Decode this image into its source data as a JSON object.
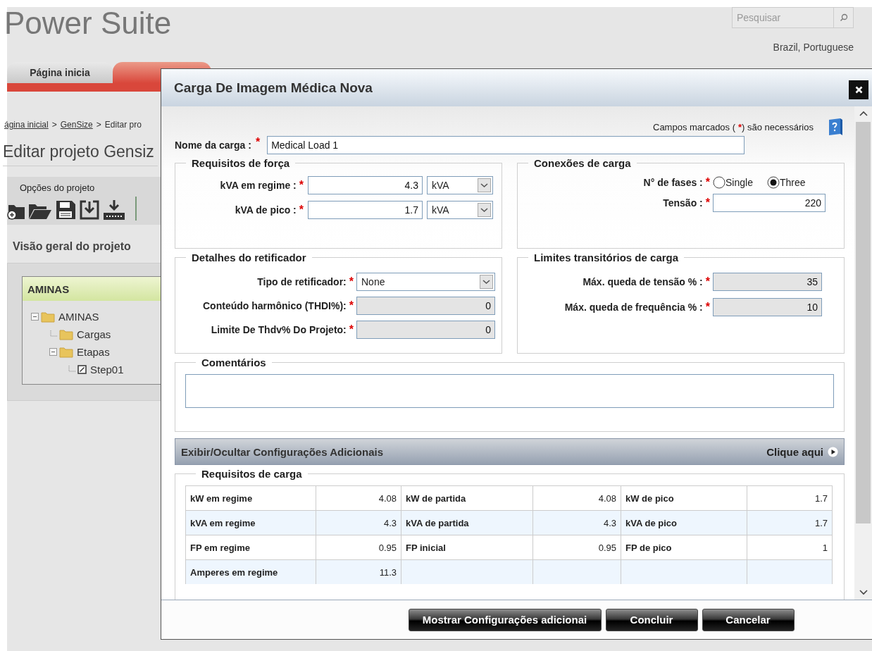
{
  "header": {
    "logo": "Power Suite",
    "search": {
      "placeholder": "Pesquisar"
    },
    "locale": "Brazil, Portuguese"
  },
  "nav_tabs": [
    {
      "label": "Página inicia",
      "selected": false
    }
  ],
  "breadcrumb": {
    "items": [
      "ágina inicial",
      "GenSize",
      "Editar pro"
    ],
    "separator": ">"
  },
  "page_title": "Editar projeto Gensiz",
  "project_options": {
    "title": "Opções do projeto"
  },
  "overview": {
    "title": "Visão geral do projeto",
    "project": "AMINAS",
    "tree": [
      {
        "label": "AMINAS",
        "kind": "folder",
        "expanded": true,
        "children": [
          {
            "label": "Cargas",
            "kind": "folder"
          },
          {
            "label": "Etapas",
            "kind": "folder",
            "expanded": true,
            "children": [
              {
                "label": "Step01",
                "kind": "step"
              }
            ]
          }
        ]
      }
    ]
  },
  "dialog": {
    "title": "Carga De Imagem Médica Nova",
    "required_note": {
      "before": "Campos marcados (",
      "mark": "*",
      "after": ") são necessários"
    },
    "name": {
      "label": "Nome da carga :",
      "mark": "*",
      "value": "Medical Load 1"
    },
    "power_requirements": {
      "title": "Requisitos de força",
      "fields": [
        {
          "label": "kVA em regime :",
          "mark": "*",
          "value": "4.3",
          "unit": "kVA"
        },
        {
          "label": "kVA de pico :",
          "mark": "*",
          "value": "1.7",
          "unit": "kVA"
        }
      ]
    },
    "connections": {
      "title": "Conexões de carga",
      "phases": {
        "label": "N° de fases :",
        "mark": "*",
        "options": [
          {
            "label": "Single",
            "selected": false
          },
          {
            "label": "Three",
            "selected": true
          }
        ]
      },
      "voltage": {
        "label": "Tensão :",
        "mark": "*",
        "value": "220"
      }
    },
    "rectifier": {
      "title": "Detalhes do retificador",
      "fields": [
        {
          "kind": "select",
          "label": "Tipo de retificador:",
          "mark": "*",
          "value": "None",
          "disabled": false
        },
        {
          "kind": "input",
          "label": "Conteúdo harmônico (THDI%):",
          "mark": "*",
          "value": "0",
          "disabled": true
        },
        {
          "kind": "input",
          "label": "Limite De Thdv% Do Projeto:",
          "mark": "*",
          "value": "0",
          "disabled": true
        }
      ]
    },
    "transient_limits": {
      "title": "Limites transitórios de carga",
      "fields": [
        {
          "label": "Máx. queda de tensão % :",
          "mark": "*",
          "value": "35",
          "disabled": true
        },
        {
          "label": "Máx. queda de frequência % :",
          "mark": "*",
          "value": "10",
          "disabled": true
        }
      ]
    },
    "comments": {
      "title": "Comentários"
    },
    "toggle_bar": {
      "label": "Exibir/Ocultar Configurações Adicionais",
      "action": "Clique aqui"
    },
    "load_requirements": {
      "title": "Requisitos de carga",
      "rows": [
        [
          "kW em regime",
          "4.08",
          "kW de partida",
          "4.08",
          "kW de pico",
          "1.7"
        ],
        [
          "kVA em regime",
          "4.3",
          "kVA de partida",
          "4.3",
          "kVA de pico",
          "1.7"
        ],
        [
          "FP em regime",
          "0.95",
          "FP inicial",
          "0.95",
          "FP de pico",
          "1"
        ],
        [
          "Amperes em regime",
          "11.3"
        ]
      ]
    },
    "buttons": [
      "Mostrar Configurações adicionai",
      "Concluir",
      "Cancelar"
    ]
  }
}
